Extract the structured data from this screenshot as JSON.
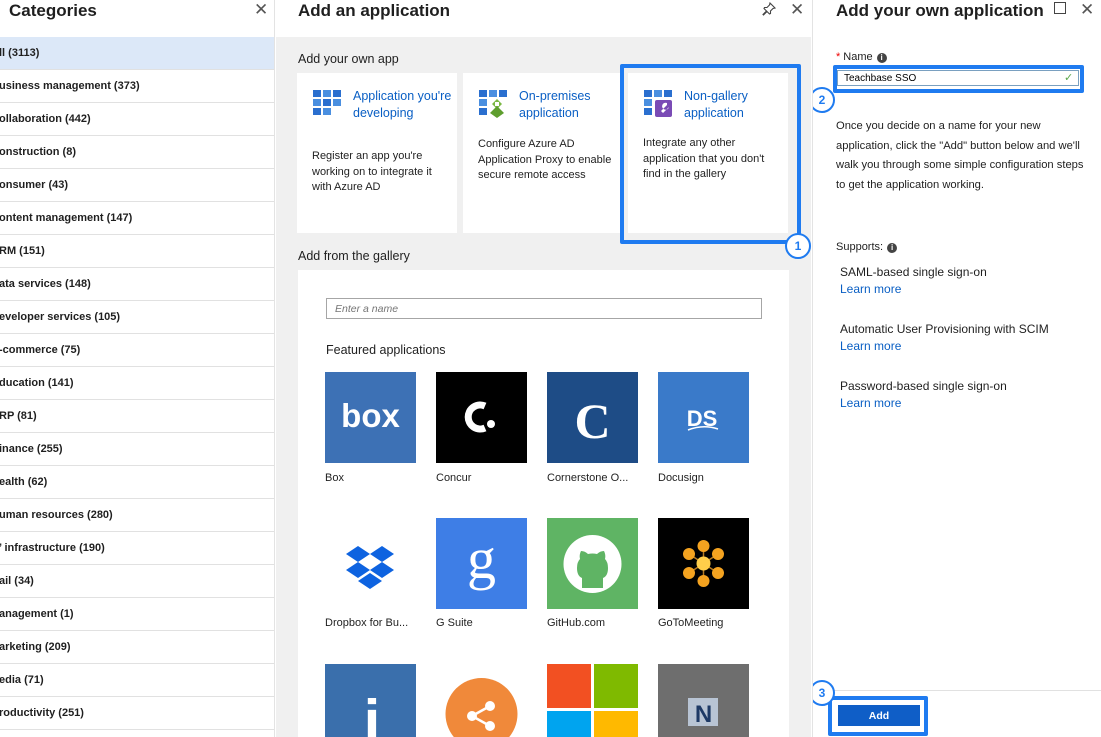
{
  "categories": {
    "title": "Categories",
    "close_icon": "close-icon",
    "items": [
      {
        "label": "ll (3113)",
        "selected": true
      },
      {
        "label": "usiness management (373)"
      },
      {
        "label": "ollaboration (442)"
      },
      {
        "label": "onstruction (8)"
      },
      {
        "label": "onsumer (43)"
      },
      {
        "label": "ontent management (147)"
      },
      {
        "label": "RM (151)"
      },
      {
        "label": "ata services (148)"
      },
      {
        "label": "eveloper services (105)"
      },
      {
        "label": "-commerce (75)"
      },
      {
        "label": "ducation (141)"
      },
      {
        "label": "RP (81)"
      },
      {
        "label": "inance (255)"
      },
      {
        "label": "ealth (62)"
      },
      {
        "label": "uman resources (280)"
      },
      {
        "label": "’ infrastructure (190)"
      },
      {
        "label": "ail (34)"
      },
      {
        "label": "anagement (1)"
      },
      {
        "label": "arketing (209)"
      },
      {
        "label": "edia (71)"
      },
      {
        "label": "roductivity (251)"
      }
    ]
  },
  "add_app": {
    "title": "Add an application",
    "pin_icon": "pin-icon",
    "close_icon": "close-icon",
    "own_section_label": "Add your own app",
    "cards": [
      {
        "name": "Application you're developing",
        "desc": "Register an app you're working on to integrate it with Azure AD",
        "icon": "app-grid-icon"
      },
      {
        "name": "On-premises application",
        "desc": "Configure Azure AD Application Proxy to enable secure remote access",
        "icon": "app-proxy-icon"
      },
      {
        "name": "Non-gallery application",
        "desc": "Integrate any other application that you don't find in the gallery",
        "icon": "app-wrench-icon",
        "highlighted": true
      }
    ],
    "gallery_section_label": "Add from the gallery",
    "search_placeholder": "Enter a name",
    "featured_label": "Featured applications",
    "featured": [
      {
        "label": "Box",
        "color": "#3d71b5"
      },
      {
        "label": "Concur",
        "color": "#000000"
      },
      {
        "label": "Cornerstone O...",
        "color": "#1e4c86"
      },
      {
        "label": "Docusign",
        "color": "#3a7ac9"
      },
      {
        "label": "Dropbox for Bu...",
        "color": "#ffffff"
      },
      {
        "label": "G Suite",
        "color": "#3e7ee6"
      },
      {
        "label": "GitHub.com",
        "color": "#5fb464"
      },
      {
        "label": "GoToMeeting",
        "color": "#000000"
      },
      {
        "label": "",
        "color": "#3a6fac"
      },
      {
        "label": "",
        "color": "#f0893a"
      },
      {
        "label": "",
        "color": "#f25022"
      },
      {
        "label": "",
        "color": "#6e6e6e"
      }
    ],
    "step_badge": "1"
  },
  "own_app": {
    "title": "Add your own application",
    "maximize_icon": "maximize-icon",
    "close_icon": "close-icon",
    "name_label": "Name",
    "required_mark": "*",
    "info_glyph": "i",
    "name_value": "Teachbase SSO",
    "check_icon": "checkmark-icon",
    "step_badge_name": "2",
    "description": "Once you decide on a name for your new application, click the \"Add\" button below and we'll walk you through some simple configuration steps to get the application working.",
    "supports_label": "Supports:",
    "supports": [
      {
        "name": "SAML-based single sign-on",
        "link": "Learn more"
      },
      {
        "name": "Automatic User Provisioning with SCIM",
        "link": "Learn more"
      },
      {
        "name": "Password-based single sign-on",
        "link": "Learn more"
      }
    ],
    "add_label": "Add",
    "step_badge_add": "3"
  },
  "colors": {
    "accent": "#1f7bf0",
    "link": "#0a5fc4",
    "primary_button": "#0f5ec7",
    "selected_row": "#dce8f8"
  }
}
